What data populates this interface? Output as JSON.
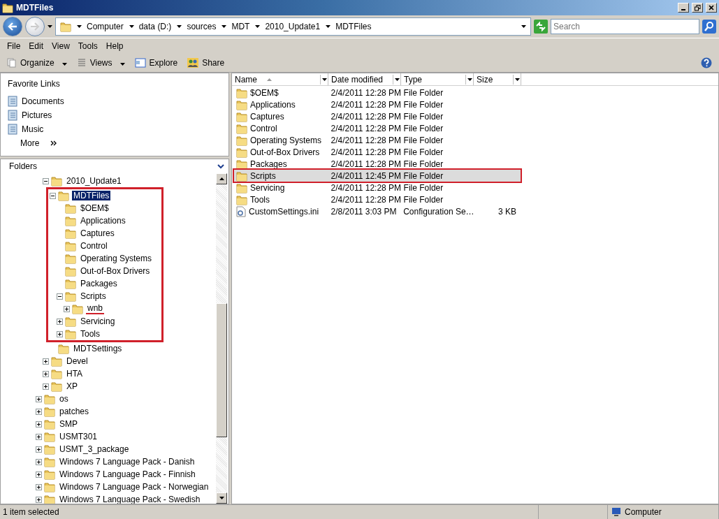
{
  "window": {
    "title": "MDTFiles"
  },
  "address_bar": {
    "crumbs": [
      "Computer",
      "data (D:)",
      "sources",
      "MDT",
      "2010_Update1",
      "MDTFiles"
    ]
  },
  "search": {
    "placeholder": "Search"
  },
  "menu": [
    "File",
    "Edit",
    "View",
    "Tools",
    "Help"
  ],
  "toolbar": [
    {
      "label": "Organize",
      "kind": "dropdown"
    },
    {
      "label": "Views",
      "kind": "dropdown"
    },
    {
      "label": "Explore",
      "kind": "plain"
    },
    {
      "label": "Share",
      "kind": "plain"
    }
  ],
  "favorite_links": {
    "title": "Favorite Links",
    "items": [
      "Documents",
      "Pictures",
      "Music"
    ],
    "more": "More"
  },
  "folders": {
    "title": "Folders",
    "tree": [
      {
        "children": [
          {
            "label": "2010_Update1",
            "kind": "branch",
            "expanded": true,
            "selected": false,
            "children": [
              {
                "label": "MDTFiles",
                "kind": "branch",
                "expanded": true,
                "selected": true,
                "boxed": true,
                "children": [
                  {
                    "label": "$OEM$",
                    "kind": "leaf",
                    "selected": false
                  },
                  {
                    "label": "Applications",
                    "kind": "leaf",
                    "selected": false
                  },
                  {
                    "label": "Captures",
                    "kind": "leaf",
                    "selected": false
                  },
                  {
                    "label": "Control",
                    "kind": "leaf",
                    "selected": false
                  },
                  {
                    "label": "Operating Systems",
                    "kind": "leaf",
                    "selected": false
                  },
                  {
                    "label": "Out-of-Box Drivers",
                    "kind": "leaf",
                    "selected": false
                  },
                  {
                    "label": "Packages",
                    "kind": "leaf",
                    "selected": false
                  },
                  {
                    "label": "Scripts",
                    "kind": "branch",
                    "expanded": true,
                    "selected": false,
                    "children": [
                      {
                        "label": "wnb",
                        "kind": "branch",
                        "expanded": false,
                        "selected": false,
                        "underlined": true
                      }
                    ]
                  },
                  {
                    "label": "Servicing",
                    "kind": "branch",
                    "expanded": false,
                    "selected": false
                  },
                  {
                    "label": "Tools",
                    "kind": "branch",
                    "expanded": false,
                    "selected": false
                  }
                ]
              },
              {
                "label": "MDTSettings",
                "kind": "leaf",
                "selected": false
              }
            ]
          },
          {
            "label": "Devel",
            "kind": "branch",
            "expanded": false,
            "selected": false
          },
          {
            "label": "HTA",
            "kind": "branch",
            "expanded": false,
            "selected": false
          },
          {
            "label": "XP",
            "kind": "branch",
            "expanded": false,
            "selected": false
          }
        ]
      },
      {
        "label": "os",
        "kind": "branch",
        "expanded": false,
        "selected": false
      },
      {
        "label": "patches",
        "kind": "branch",
        "expanded": false,
        "selected": false
      },
      {
        "label": "SMP",
        "kind": "branch",
        "expanded": false,
        "selected": false
      },
      {
        "label": "USMT301",
        "kind": "branch",
        "expanded": false,
        "selected": false
      },
      {
        "label": "USMT_3_package",
        "kind": "branch",
        "expanded": false,
        "selected": false
      },
      {
        "label": "Windows 7 Language Pack - Danish",
        "kind": "branch",
        "expanded": false,
        "selected": false
      },
      {
        "label": "Windows 7 Language Pack - Finnish",
        "kind": "branch",
        "expanded": false,
        "selected": false
      },
      {
        "label": "Windows 7 Language Pack - Norwegian",
        "kind": "branch",
        "expanded": false,
        "selected": false
      },
      {
        "label": "Windows 7 Language Pack - Swedish",
        "kind": "branch",
        "expanded": false,
        "selected": false
      }
    ]
  },
  "files": {
    "columns": [
      {
        "label": "Name",
        "sorted": true
      },
      {
        "label": "Date modified",
        "sorted": false
      },
      {
        "label": "Type",
        "sorted": false
      },
      {
        "label": "Size",
        "sorted": false
      }
    ],
    "rows": [
      {
        "name": "$OEM$",
        "date": "2/4/2011 12:28 PM",
        "type": "File Folder",
        "kind": "folder",
        "selected": false
      },
      {
        "name": "Applications",
        "date": "2/4/2011 12:28 PM",
        "type": "File Folder",
        "kind": "folder",
        "selected": false
      },
      {
        "name": "Captures",
        "date": "2/4/2011 12:28 PM",
        "type": "File Folder",
        "kind": "folder",
        "selected": false
      },
      {
        "name": "Control",
        "date": "2/4/2011 12:28 PM",
        "type": "File Folder",
        "kind": "folder",
        "selected": false
      },
      {
        "name": "Operating Systems",
        "date": "2/4/2011 12:28 PM",
        "type": "File Folder",
        "kind": "folder",
        "selected": false
      },
      {
        "name": "Out-of-Box Drivers",
        "date": "2/4/2011 12:28 PM",
        "type": "File Folder",
        "kind": "folder",
        "selected": false
      },
      {
        "name": "Packages",
        "date": "2/4/2011 12:28 PM",
        "type": "File Folder",
        "kind": "folder",
        "selected": false
      },
      {
        "name": "Scripts",
        "date": "2/4/2011 12:45 PM",
        "type": "File Folder",
        "kind": "folder",
        "selected": true,
        "boxed": true
      },
      {
        "name": "Servicing",
        "date": "2/4/2011 12:28 PM",
        "type": "File Folder",
        "kind": "folder",
        "selected": false
      },
      {
        "name": "Tools",
        "date": "2/4/2011 12:28 PM",
        "type": "File Folder",
        "kind": "folder",
        "selected": false
      },
      {
        "name": "CustomSettings.ini",
        "date": "2/8/2011 3:03 PM",
        "type": "Configuration Se…",
        "size": "3 KB",
        "kind": "file",
        "selected": false
      }
    ]
  },
  "status_bar": {
    "text": "1 item selected",
    "location": "Computer"
  }
}
